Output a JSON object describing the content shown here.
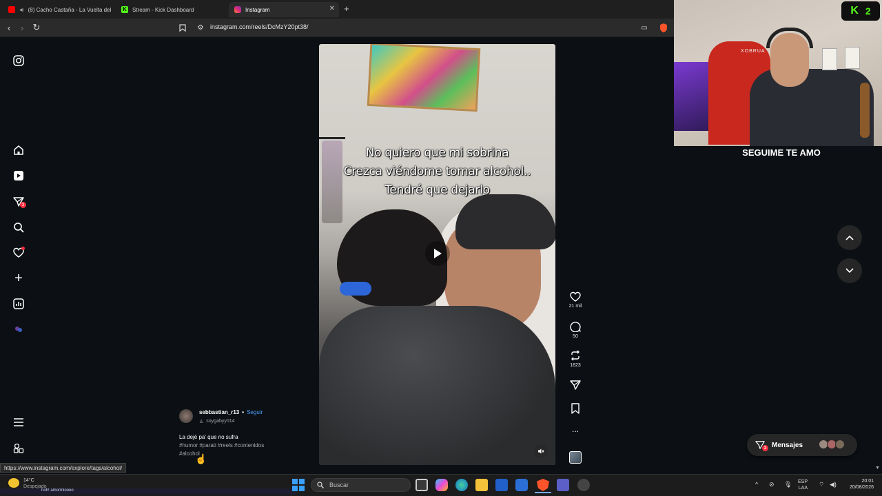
{
  "browser": {
    "tabs": [
      {
        "label": "(8) Cacho Castaña - La Vuelta del",
        "active": false
      },
      {
        "label": "Stream - Kick Dashboard",
        "active": false
      },
      {
        "label": "Instagram",
        "active": true
      }
    ],
    "new_tab": "+",
    "url": "instagram.com/reels/DcMzY20pt38/"
  },
  "sidebar": {
    "notifications_badge": "3"
  },
  "reel": {
    "caption_lines": [
      "No quiero que mi sobrina",
      "Crezca viéndome tomar alcohol..",
      "Tendré que dejarlo"
    ],
    "author": "sebbastian_r13",
    "follow_sep": "•",
    "follow_label": "Seguir",
    "audio": "soygabyy014",
    "description": "La dejé pa' que no sufra",
    "hashtags_line1": "#humor #parati #reels #contenidos",
    "hashtags_line2": "#alcohol"
  },
  "actions": {
    "likes": "21 mil",
    "comments": "50",
    "reposts": "1823",
    "more": "..."
  },
  "webcam": {
    "kick_label": "2",
    "overlay_text": "SEGUIME TE AMO",
    "chair_text": "XOBRUA"
  },
  "messages": {
    "label": "Mensajes",
    "badge": "3"
  },
  "status_link": "https://www.instagram.com/explore/tags/alcohol/",
  "taskbar": {
    "weather_temp": "14°C",
    "weather_desc": "Despejado",
    "search_placeholder": "Buscar",
    "lang_line1": "ESP",
    "lang_line2": "LAA",
    "time": "20:01",
    "date": "20/08/2026",
    "media_text": "hoh! amormioooo"
  },
  "colors": {
    "ig_bg": "#0c1014",
    "link_blue": "#4a9eff",
    "badge_red": "#ff3040",
    "kick_green": "#53fc18"
  }
}
